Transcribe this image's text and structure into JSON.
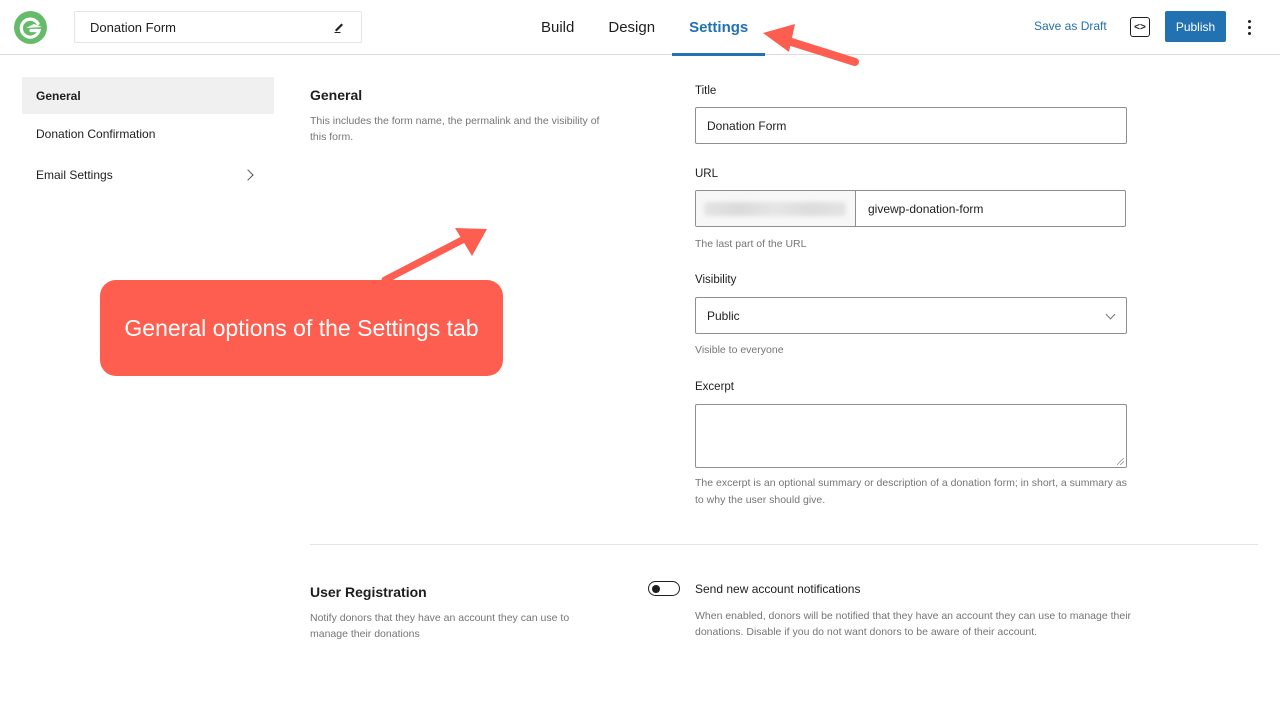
{
  "header": {
    "logo": "givewp-logo-icon",
    "form_title": "Donation Form",
    "edit_icon": "pencil-icon",
    "tabs": [
      {
        "label": "Build",
        "active": false
      },
      {
        "label": "Design",
        "active": false
      },
      {
        "label": "Settings",
        "active": true
      }
    ],
    "save_draft_label": "Save as Draft",
    "code_icon": "code-brackets-icon",
    "code_glyph": "<>",
    "publish_label": "Publish",
    "more_icon": "vertical-ellipsis-icon",
    "accent_color": "#2271b1"
  },
  "sidebar": {
    "items": [
      {
        "label": "General",
        "active": true
      },
      {
        "label": "Donation Confirmation",
        "active": false
      },
      {
        "label": "Email Settings",
        "active": false,
        "has_submenu": true
      }
    ]
  },
  "general": {
    "title": "General",
    "description": "This includes the form name, the permalink and the visibility of this form.",
    "fields": {
      "title_label": "Title",
      "title_value": "Donation Form",
      "url_label": "URL",
      "url_prefix": "(blurred)",
      "url_slug": "givewp-donation-form",
      "url_help": "The last part of the URL",
      "visibility_label": "Visibility",
      "visibility_value": "Public",
      "visibility_help": "Visible to everyone",
      "excerpt_label": "Excerpt",
      "excerpt_value": "",
      "excerpt_help": "The excerpt is an optional summary or description of a donation form; in short, a summary as to why the user should give."
    }
  },
  "user_registration": {
    "title": "User Registration",
    "description": "Notify donors that they have an account they can use to manage their donations",
    "toggle_label": "Send new account notifications",
    "toggle_on": false,
    "toggle_help": "When enabled, donors will be notified that they have an account they can use to manage their donations. Disable if you do not want donors to be aware of their account."
  },
  "annotation": {
    "callout_text": "General options of the Settings tab",
    "color": "#fd5e4f"
  }
}
